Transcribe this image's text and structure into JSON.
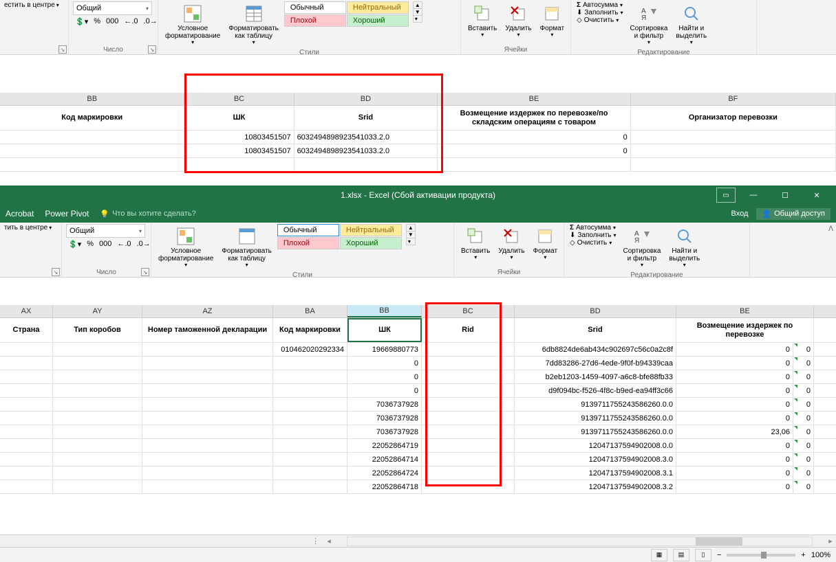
{
  "ribbon_top": {
    "align_center": "естить в центре",
    "numfmt": "Общий",
    "pct": "%",
    "thou": "000",
    "dec_inc": ",0 .00",
    "dec_dec": ",00 .0",
    "group_number": "Число",
    "cond_fmt": "Условное\nформатирование",
    "fmt_table": "Форматировать\nкак таблицу",
    "style_normal": "Обычный",
    "style_neutral": "Нейтральный",
    "style_bad": "Плохой",
    "style_good": "Хороший",
    "group_styles": "Стили",
    "insert": "Вставить",
    "delete": "Удалить",
    "format": "Формат",
    "group_cells": "Ячейки",
    "autosum": "Автосумма",
    "fill": "Заполнить",
    "clear": "Очистить",
    "sort_filter": "Сортировка\nи фильтр",
    "find_select": "Найти и\nвыделить",
    "group_editing": "Редактирование"
  },
  "top_grid": {
    "cols": {
      "BB": "BB",
      "BC": "BC",
      "BD": "BD",
      "BE": "BE",
      "BF": "BF"
    },
    "headers": {
      "BB": "Код маркировки",
      "BC": "ШК",
      "BD": "Srid",
      "BE": "Возмещение издержек по перевозке/по складским операциям с товаром",
      "BF": "Организатор перевозки"
    },
    "rows": [
      {
        "BC": "10803451507",
        "BD": "6032494898923541033.2.0",
        "BE": "0"
      },
      {
        "BC": "10803451507",
        "BD": "6032494898923541033.2.0",
        "BE": "0"
      }
    ]
  },
  "bottom_window": {
    "title": "1.xlsx - Excel (Сбой активации продукта)",
    "acrobat": "Acrobat",
    "powerpivot": "Power Pivot",
    "tellme": "Что вы хотите сделать?",
    "login": "Вход",
    "share": "Общий доступ"
  },
  "ribbon_bottom": {
    "align_center": "тить в центре",
    "numfmt": "Общий",
    "group_number": "Число",
    "cond_fmt": "Условное\nформатирование",
    "fmt_table": "Форматировать\nкак таблицу",
    "style_normal": "Обычный",
    "style_neutral": "Нейтральный",
    "style_bad": "Плохой",
    "style_good": "Хороший",
    "group_styles": "Стили",
    "insert": "Вставить",
    "delete": "Удалить",
    "format": "Формат",
    "group_cells": "Ячейки",
    "autosum": "Автосумма",
    "fill": "Заполнить",
    "clear": "Очистить",
    "sort_filter": "Сортировка\nи фильтр",
    "find_select": "Найти и\nвыделить",
    "group_editing": "Редактирование"
  },
  "bottom_grid": {
    "cols": {
      "AX": "AX",
      "AY": "AY",
      "AZ": "AZ",
      "BA": "BA",
      "BB": "BB",
      "BC": "BC",
      "BD": "BD",
      "BE": "BE"
    },
    "headers": {
      "AX": "Страна",
      "AY": "Тип коробов",
      "AZ": "Номер таможенной декларации",
      "BA": "Код маркировки",
      "BB": "ШК",
      "BC": "Rid",
      "BD": "Srid",
      "BE": "Возмещение издержек по перевозке"
    },
    "rows": [
      {
        "BA": "010462020292334",
        "BB": "19669880773",
        "BD": "6db8824de6ab434c902697c56c0a2c8f",
        "BE": "0",
        "BE2": "0"
      },
      {
        "BA": "",
        "BB": "0",
        "BD": "7dd83286-27d6-4ede-9f0f-b94339caa",
        "BE": "0",
        "BE2": "0"
      },
      {
        "BA": "",
        "BB": "0",
        "BD": "b2eb1203-1459-4097-a6c8-bfe88fb33",
        "BE": "0",
        "BE2": "0"
      },
      {
        "BA": "",
        "BB": "0",
        "BD": "d9f094bc-f526-4f8c-b9ed-ea94ff3c66",
        "BE": "0",
        "BE2": "0"
      },
      {
        "BA": "",
        "BB": "7036737928",
        "BD": "9139711755243586260.0.0",
        "BE": "0",
        "BE2": "0"
      },
      {
        "BA": "",
        "BB": "7036737928",
        "BD": "9139711755243586260.0.0",
        "BE": "0",
        "BE2": "0"
      },
      {
        "BA": "",
        "BB": "7036737928",
        "BD": "9139711755243586260.0.0",
        "BE": "23,06",
        "BE2": "0"
      },
      {
        "BA": "",
        "BB": "22052864719",
        "BD": "12047137594902008.0.0",
        "BE": "0",
        "BE2": "0"
      },
      {
        "BA": "",
        "BB": "22052864714",
        "BD": "12047137594902008.3.0",
        "BE": "0",
        "BE2": "0"
      },
      {
        "BA": "",
        "BB": "22052864724",
        "BD": "12047137594902008.3.1",
        "BE": "0",
        "BE2": "0"
      },
      {
        "BA": "",
        "BB": "22052864718",
        "BD": "12047137594902008.3.2",
        "BE": "0",
        "BE2": "0"
      }
    ]
  },
  "status": {
    "zoom": "100%"
  }
}
